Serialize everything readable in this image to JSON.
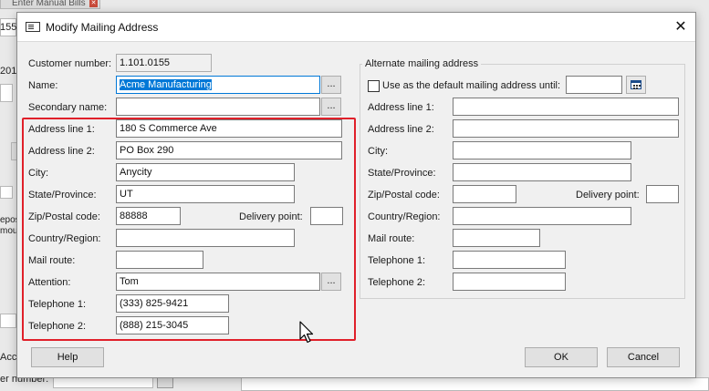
{
  "background": {
    "tab_label": "Enter Manual Bills",
    "left_fragments": [
      "155",
      "201",
      "epos",
      "mou",
      "Acco",
      "er number:"
    ]
  },
  "dialog": {
    "title": "Modify Mailing Address",
    "close_glyph": "✕",
    "customer_number_label": "Customer number:",
    "customer_number": "1.101.0155",
    "name_label": "Name:",
    "name_value": "Acme Manufacturing",
    "secondary_name_label": "Secondary name:",
    "secondary_name_value": "",
    "ellipsis": "...",
    "main": {
      "address1_label": "Address line 1:",
      "address1": "180 S Commerce Ave",
      "address2_label": "Address line 2:",
      "address2": "PO Box 290",
      "city_label": "City:",
      "city": "Anycity",
      "state_label": "State/Province:",
      "state": "UT",
      "zip_label": "Zip/Postal code:",
      "zip": "88888",
      "delivery_label": "Delivery point:",
      "delivery": "",
      "country_label": "Country/Region:",
      "country": "",
      "mail_route_label": "Mail route:",
      "mail_route": "",
      "attention_label": "Attention:",
      "attention": "Tom",
      "tel1_label": "Telephone 1:",
      "tel1": "(333) 825-9421",
      "tel2_label": "Telephone 2:",
      "tel2": "(888) 215-3045"
    },
    "alternate": {
      "group_title": "Alternate mailing address",
      "use_default_label": "Use as the default mailing address until:",
      "use_default_checked": false,
      "until_date": "",
      "address1_label": "Address line 1:",
      "address2_label": "Address line 2:",
      "city_label": "City:",
      "state_label": "State/Province:",
      "zip_label": "Zip/Postal code:",
      "delivery_label": "Delivery point:",
      "country_label": "Country/Region:",
      "mail_route_label": "Mail route:",
      "tel1_label": "Telephone 1:",
      "tel2_label": "Telephone 2:"
    },
    "buttons": {
      "help": "Help",
      "ok": "OK",
      "cancel": "Cancel"
    }
  },
  "colors": {
    "highlight_border": "#e0202a",
    "selection": "#0078d7"
  }
}
